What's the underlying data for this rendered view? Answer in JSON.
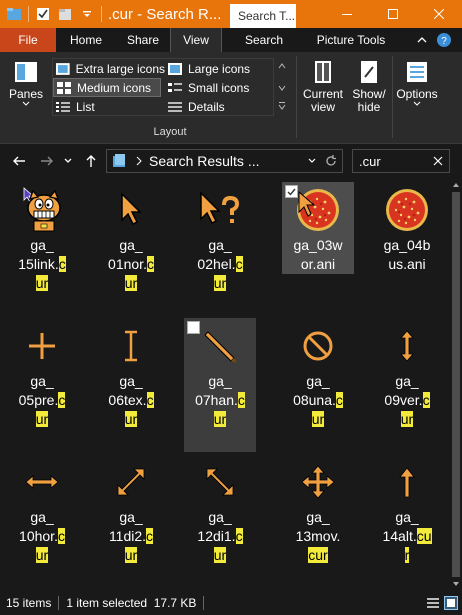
{
  "window": {
    "title": ".cur - Search R...",
    "context_tab": "Search T..."
  },
  "ribbon_tabs": [
    {
      "label": "File"
    },
    {
      "label": "Home"
    },
    {
      "label": "Share"
    },
    {
      "label": "View"
    },
    {
      "label": "Search"
    },
    {
      "label": "Picture Tools"
    }
  ],
  "ribbon": {
    "panes_label": "Panes",
    "layout_items": [
      {
        "label": "Extra large icons"
      },
      {
        "label": "Large icons"
      },
      {
        "label": "Medium icons"
      },
      {
        "label": "Small icons"
      },
      {
        "label": "List"
      },
      {
        "label": "Details"
      }
    ],
    "layout_group_label": "Layout",
    "current_view_label_1": "Current",
    "current_view_label_2": "view",
    "show_hide_label_1": "Show/",
    "show_hide_label_2": "hide",
    "options_label": "Options"
  },
  "address": {
    "path": "Search Results ...",
    "search_value": ".cur"
  },
  "files": [
    {
      "name_pre": "ga_\n15link.",
      "hit": "c\nur",
      "icon": "garfield-link-icon"
    },
    {
      "name_pre": "ga_\n01nor.",
      "hit": "c\nur",
      "icon": "arrow-cursor-icon"
    },
    {
      "name_pre": "ga_\n02hel.",
      "hit": "c\nur",
      "icon": "help-cursor-icon"
    },
    {
      "name_pre": "ga_03w\nor.ani",
      "hit": "",
      "icon": "pizza-icon"
    },
    {
      "name_pre": "ga_04b\nus.ani",
      "hit": "",
      "icon": "pizza-icon"
    },
    {
      "name_pre": "ga_\n05pre.",
      "hit": "c\nur",
      "icon": "crosshair-cursor-icon"
    },
    {
      "name_pre": "ga_\n06tex.",
      "hit": "c\nur",
      "icon": "text-cursor-icon"
    },
    {
      "name_pre": "ga_\n07han.",
      "hit": "c\nur",
      "icon": "pen-cursor-icon"
    },
    {
      "name_pre": "ga_\n08una.",
      "hit": "c\nur",
      "icon": "unavailable-cursor-icon"
    },
    {
      "name_pre": "ga_\n09ver.",
      "hit": "c\nur",
      "icon": "vertical-resize-icon"
    },
    {
      "name_pre": "ga_\n10hor.",
      "hit": "c\nur",
      "icon": "horizontal-resize-icon"
    },
    {
      "name_pre": "ga_\n11di2.",
      "hit": "c\nur",
      "icon": "diagonal-resize-2-icon"
    },
    {
      "name_pre": "ga_\n12di1.",
      "hit": "c\nur",
      "icon": "diagonal-resize-1-icon"
    },
    {
      "name_pre": "ga_\n13mov.",
      "hit": "\ncur",
      "icon": "move-cursor-icon"
    },
    {
      "name_pre": "ga_\n14alt.",
      "hit": "cu\nr",
      "icon": "alternate-cursor-icon"
    }
  ],
  "status": {
    "count": "15 items",
    "selection": "1 item selected  17.7 KB"
  },
  "colors": {
    "titlebar": "#e8740c",
    "file_tab": "#c9451a",
    "highlight": "#f2eb3c",
    "cursor_orange": "#f0a040"
  }
}
